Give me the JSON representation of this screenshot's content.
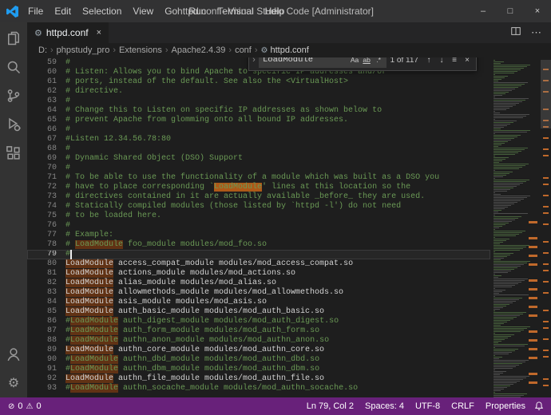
{
  "colors": {
    "accent": "#007acc",
    "status_bar": "#68217a",
    "editor_bg": "#1e1e1e",
    "comment_green": "#6a9955",
    "match_highlight": "#613214",
    "current_match": "#ad5918"
  },
  "window": {
    "title": "httpd.conf - Visual Studio Code [Administrator]",
    "menu_items": [
      "File",
      "Edit",
      "Selection",
      "View",
      "Go",
      "Run",
      "Terminal",
      "Help"
    ],
    "minimize_glyph": "–",
    "maximize_glyph": "□",
    "close_glyph": "×"
  },
  "activity_bar": {
    "items": [
      "explorer",
      "search",
      "source-control",
      "run-and-debug",
      "extensions"
    ],
    "bottom_items": [
      "accounts",
      "manage"
    ]
  },
  "editor_group": {
    "tabs": [
      {
        "label": "httpd.conf",
        "active": true
      }
    ],
    "tab_icon_glyph": "⚙",
    "tab_close_glyph": "×",
    "more_actions_glyph": "⋯"
  },
  "breadcrumb": {
    "separator": "›",
    "items": [
      "D:",
      "phpstudy_pro",
      "Extensions",
      "Apache2.4.39",
      "conf"
    ],
    "file": "httpd.conf",
    "file_icon_glyph": "⚙"
  },
  "find_widget": {
    "toggle_replace_glyph": "›",
    "query": "LoadModule",
    "match_case": "Aa",
    "whole_word": "ab",
    "use_regex": ".*",
    "results": "1 of 117",
    "prev_glyph": "↑",
    "next_glyph": "↓",
    "selection_glyph": "≡",
    "close_glyph": "×"
  },
  "editor": {
    "cursor": {
      "line": 79,
      "col": 2
    },
    "lines": [
      [
        59,
        [
          [
            "#",
            "c"
          ]
        ]
      ],
      [
        60,
        [
          [
            "# Listen: Allows you to bind Apache to specific IP addresses and/or",
            "c"
          ]
        ]
      ],
      [
        61,
        [
          [
            "# ports, instead of the default. See also the <VirtualHost>",
            "c"
          ]
        ]
      ],
      [
        62,
        [
          [
            "# directive.",
            "c"
          ]
        ]
      ],
      [
        63,
        [
          [
            "#",
            "c"
          ]
        ]
      ],
      [
        64,
        [
          [
            "# Change this to Listen on specific IP addresses as shown below to",
            "c"
          ]
        ]
      ],
      [
        65,
        [
          [
            "# prevent Apache from glomming onto all bound IP addresses.",
            "c"
          ]
        ]
      ],
      [
        66,
        [
          [
            "#",
            "c"
          ]
        ]
      ],
      [
        67,
        [
          [
            "#Listen 12.34.56.78:80",
            "c"
          ]
        ]
      ],
      [
        68,
        [
          [
            "#",
            "c"
          ]
        ]
      ],
      [
        69,
        [
          [
            "# Dynamic Shared Object (DSO) Support",
            "c"
          ]
        ]
      ],
      [
        70,
        [
          [
            "#",
            "c"
          ]
        ]
      ],
      [
        71,
        [
          [
            "# To be able to use the functionality of a module which was built as a DSO you",
            "c"
          ]
        ]
      ],
      [
        72,
        [
          [
            "# have to place corresponding `",
            "c"
          ],
          [
            "LoadModule",
            "c mc"
          ],
          [
            "' lines at this location so the",
            "c"
          ]
        ]
      ],
      [
        73,
        [
          [
            "# directives contained in it are actually available _before_ they are used.",
            "c"
          ]
        ]
      ],
      [
        74,
        [
          [
            "# Statically compiled modules (those listed by `httpd -l') do not need",
            "c"
          ]
        ]
      ],
      [
        75,
        [
          [
            "# to be loaded here.",
            "c"
          ]
        ]
      ],
      [
        76,
        [
          [
            "#",
            "c"
          ]
        ]
      ],
      [
        77,
        [
          [
            "# Example:",
            "c"
          ]
        ]
      ],
      [
        78,
        [
          [
            "# ",
            "c"
          ],
          [
            "LoadModule",
            "c m"
          ],
          [
            " foo_module modules/mod_foo.so",
            "c"
          ]
        ]
      ],
      [
        79,
        [
          [
            "#",
            "c"
          ]
        ]
      ],
      [
        80,
        [
          [
            "LoadModule",
            "p m"
          ],
          [
            " access_compat_module modules/mod_access_compat.so",
            "p"
          ]
        ]
      ],
      [
        81,
        [
          [
            "LoadModule",
            "p m"
          ],
          [
            " actions_module modules/mod_actions.so",
            "p"
          ]
        ]
      ],
      [
        82,
        [
          [
            "LoadModule",
            "p m"
          ],
          [
            " alias_module modules/mod_alias.so",
            "p"
          ]
        ]
      ],
      [
        83,
        [
          [
            "LoadModule",
            "p m"
          ],
          [
            " allowmethods_module modules/mod_allowmethods.so",
            "p"
          ]
        ]
      ],
      [
        84,
        [
          [
            "LoadModule",
            "p m"
          ],
          [
            " asis_module modules/mod_asis.so",
            "p"
          ]
        ]
      ],
      [
        85,
        [
          [
            "LoadModule",
            "p m"
          ],
          [
            " auth_basic_module modules/mod_auth_basic.so",
            "p"
          ]
        ]
      ],
      [
        86,
        [
          [
            "#",
            "c"
          ],
          [
            "LoadModule",
            "c m"
          ],
          [
            " auth_digest_module modules/mod_auth_digest.so",
            "c"
          ]
        ]
      ],
      [
        87,
        [
          [
            "#",
            "c"
          ],
          [
            "LoadModule",
            "c m"
          ],
          [
            " auth_form_module modules/mod_auth_form.so",
            "c"
          ]
        ]
      ],
      [
        88,
        [
          [
            "#",
            "c"
          ],
          [
            "LoadModule",
            "c m"
          ],
          [
            " authn_anon_module modules/mod_authn_anon.so",
            "c"
          ]
        ]
      ],
      [
        89,
        [
          [
            "LoadModule",
            "p m"
          ],
          [
            " authn_core_module modules/mod_authn_core.so",
            "p"
          ]
        ]
      ],
      [
        90,
        [
          [
            "#",
            "c"
          ],
          [
            "LoadModule",
            "c m"
          ],
          [
            " authn_dbd_module modules/mod_authn_dbd.so",
            "c"
          ]
        ]
      ],
      [
        91,
        [
          [
            "#",
            "c"
          ],
          [
            "LoadModule",
            "c m"
          ],
          [
            " authn_dbm_module modules/mod_authn_dbm.so",
            "c"
          ]
        ]
      ],
      [
        92,
        [
          [
            "LoadModule",
            "p m"
          ],
          [
            " authn_file_module modules/mod_authn_file.so",
            "p"
          ]
        ]
      ],
      [
        93,
        [
          [
            "#",
            "c"
          ],
          [
            "LoadModule",
            "c m"
          ],
          [
            " authn_socache_module modules/mod_authn_socache.so",
            "c"
          ]
        ]
      ]
    ]
  },
  "status_bar": {
    "errors_icon": "⊘",
    "errors": "0",
    "warnings_icon": "⚠",
    "warnings": "0",
    "items": [
      {
        "name": "cursor-position",
        "label": "Ln 79, Col 2"
      },
      {
        "name": "indentation",
        "label": "Spaces: 4"
      },
      {
        "name": "encoding",
        "label": "UTF-8"
      },
      {
        "name": "eol",
        "label": "CRLF"
      },
      {
        "name": "language-mode",
        "label": "Properties"
      }
    ]
  }
}
